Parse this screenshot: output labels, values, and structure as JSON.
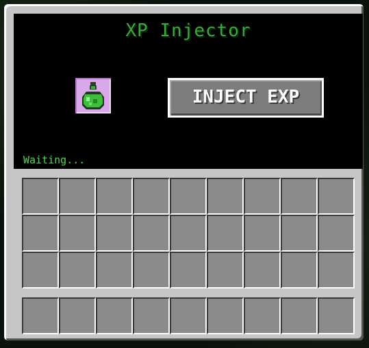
{
  "window": {
    "title": "XP Injector"
  },
  "controls": {
    "inject_label": "INJECT EXP",
    "status_text": "Waiting..."
  },
  "slots": {
    "input_item": "experience-bottle-icon",
    "main_inventory_count": 27,
    "hotbar_count": 9
  },
  "colors": {
    "title": "#3aa83a",
    "status": "#4cd84c",
    "panel": "#000000",
    "frame": "#c6c6c6",
    "slot_highlight": "#d8a8e8"
  }
}
